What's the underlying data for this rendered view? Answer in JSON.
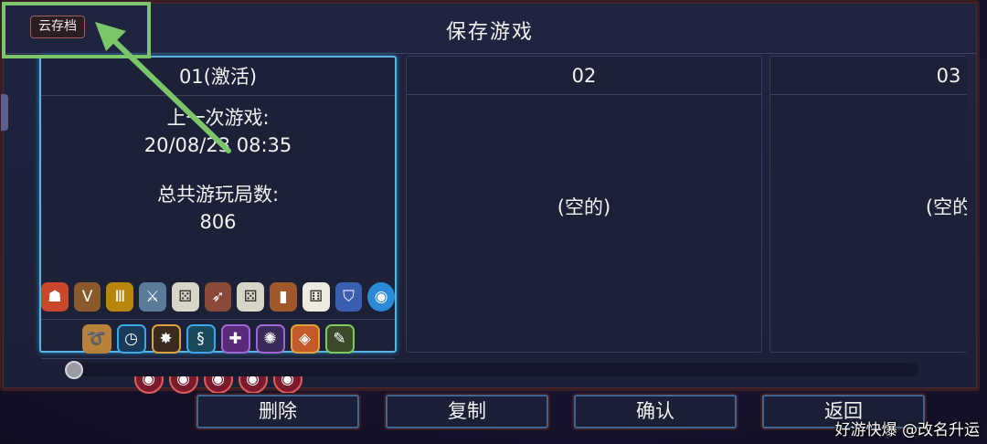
{
  "header": {
    "title": "保存游戏",
    "cloud_save_label": "云存档"
  },
  "slots": [
    {
      "name": "01(激活)",
      "last_played_label": "上一次游戏:",
      "last_played_value": "20/08/23 08:35",
      "total_runs_label": "总共游玩局数:",
      "total_runs_value": "806"
    },
    {
      "name": "02",
      "status": "(空的)"
    },
    {
      "name": "03",
      "status": "(空的"
    }
  ],
  "icons_row1": [
    "fire-bag-icon",
    "money-bag-icon",
    "card-icon",
    "sword-icon",
    "dice-icon",
    "bow-icon",
    "dice-icon",
    "barrel-icon",
    "dice-icon",
    "shield-icon",
    "orb-icon"
  ],
  "icons_row2": [
    "horn-icon",
    "clock-icon",
    "spider-icon",
    "dna-icon",
    "potion-icon",
    "beetle-icon",
    "gem-icon",
    "wrench-icon"
  ],
  "icons_row3": [
    "eye-medal-icon",
    "eye-medal-icon",
    "eye-medal-icon",
    "eye-medal-icon",
    "eye-medal-icon"
  ],
  "buttons": {
    "delete": "删除",
    "copy": "复制",
    "confirm": "确认",
    "back": "返回"
  },
  "watermark": "好游快爆 @改名升运",
  "colors": {
    "active_border": "#57b5e3",
    "highlight": "#7cc66a",
    "cloud_button_border": "#a75c5c"
  }
}
